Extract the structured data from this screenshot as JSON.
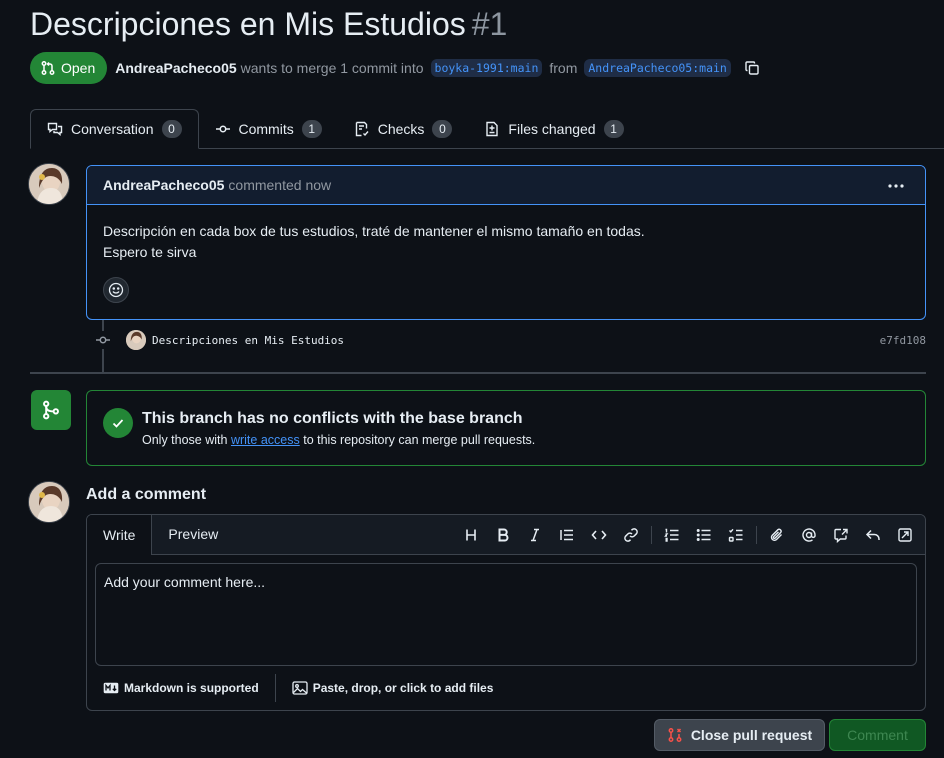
{
  "header": {
    "title": "Descripciones en Mis Estudios",
    "number": "#1",
    "state": "Open",
    "author": "AndreaPacheco05",
    "merge_text": "wants to merge 1 commit into",
    "base_branch": "boyka-1991:main",
    "from_text": "from",
    "head_branch": "AndreaPacheco05:main"
  },
  "tabs": [
    {
      "label": "Conversation",
      "count": "0",
      "icon": "comment-discussion-icon"
    },
    {
      "label": "Commits",
      "count": "1",
      "icon": "git-commit-icon"
    },
    {
      "label": "Checks",
      "count": "0",
      "icon": "checklist-icon"
    },
    {
      "label": "Files changed",
      "count": "1",
      "icon": "file-diff-icon"
    }
  ],
  "comment": {
    "author": "AndreaPacheco05",
    "action": "commented now",
    "body_line1": "Descripción en cada box de tus estudios, traté de mantener el mismo tamaño en todas.",
    "body_line2": "Espero te sirva"
  },
  "commit": {
    "message": "Descripciones en Mis Estudios",
    "sha": "e7fd108"
  },
  "merge": {
    "title": "This branch has no conflicts with the base branch",
    "sub_prefix": "Only those with",
    "sub_link": "write access",
    "sub_suffix": "to this repository can merge pull requests."
  },
  "add_comment": {
    "title": "Add a comment",
    "tab_write": "Write",
    "tab_preview": "Preview",
    "placeholder": "Add your comment here...",
    "markdown_note": "Markdown is supported",
    "attach_note": "Paste, drop, or click to add files"
  },
  "buttons": {
    "close_pr": "Close pull request",
    "comment": "Comment"
  },
  "colors": {
    "background": "#0d1117",
    "accent_green": "#238636",
    "accent_blue": "#4493f8",
    "close_icon": "#f85149"
  }
}
